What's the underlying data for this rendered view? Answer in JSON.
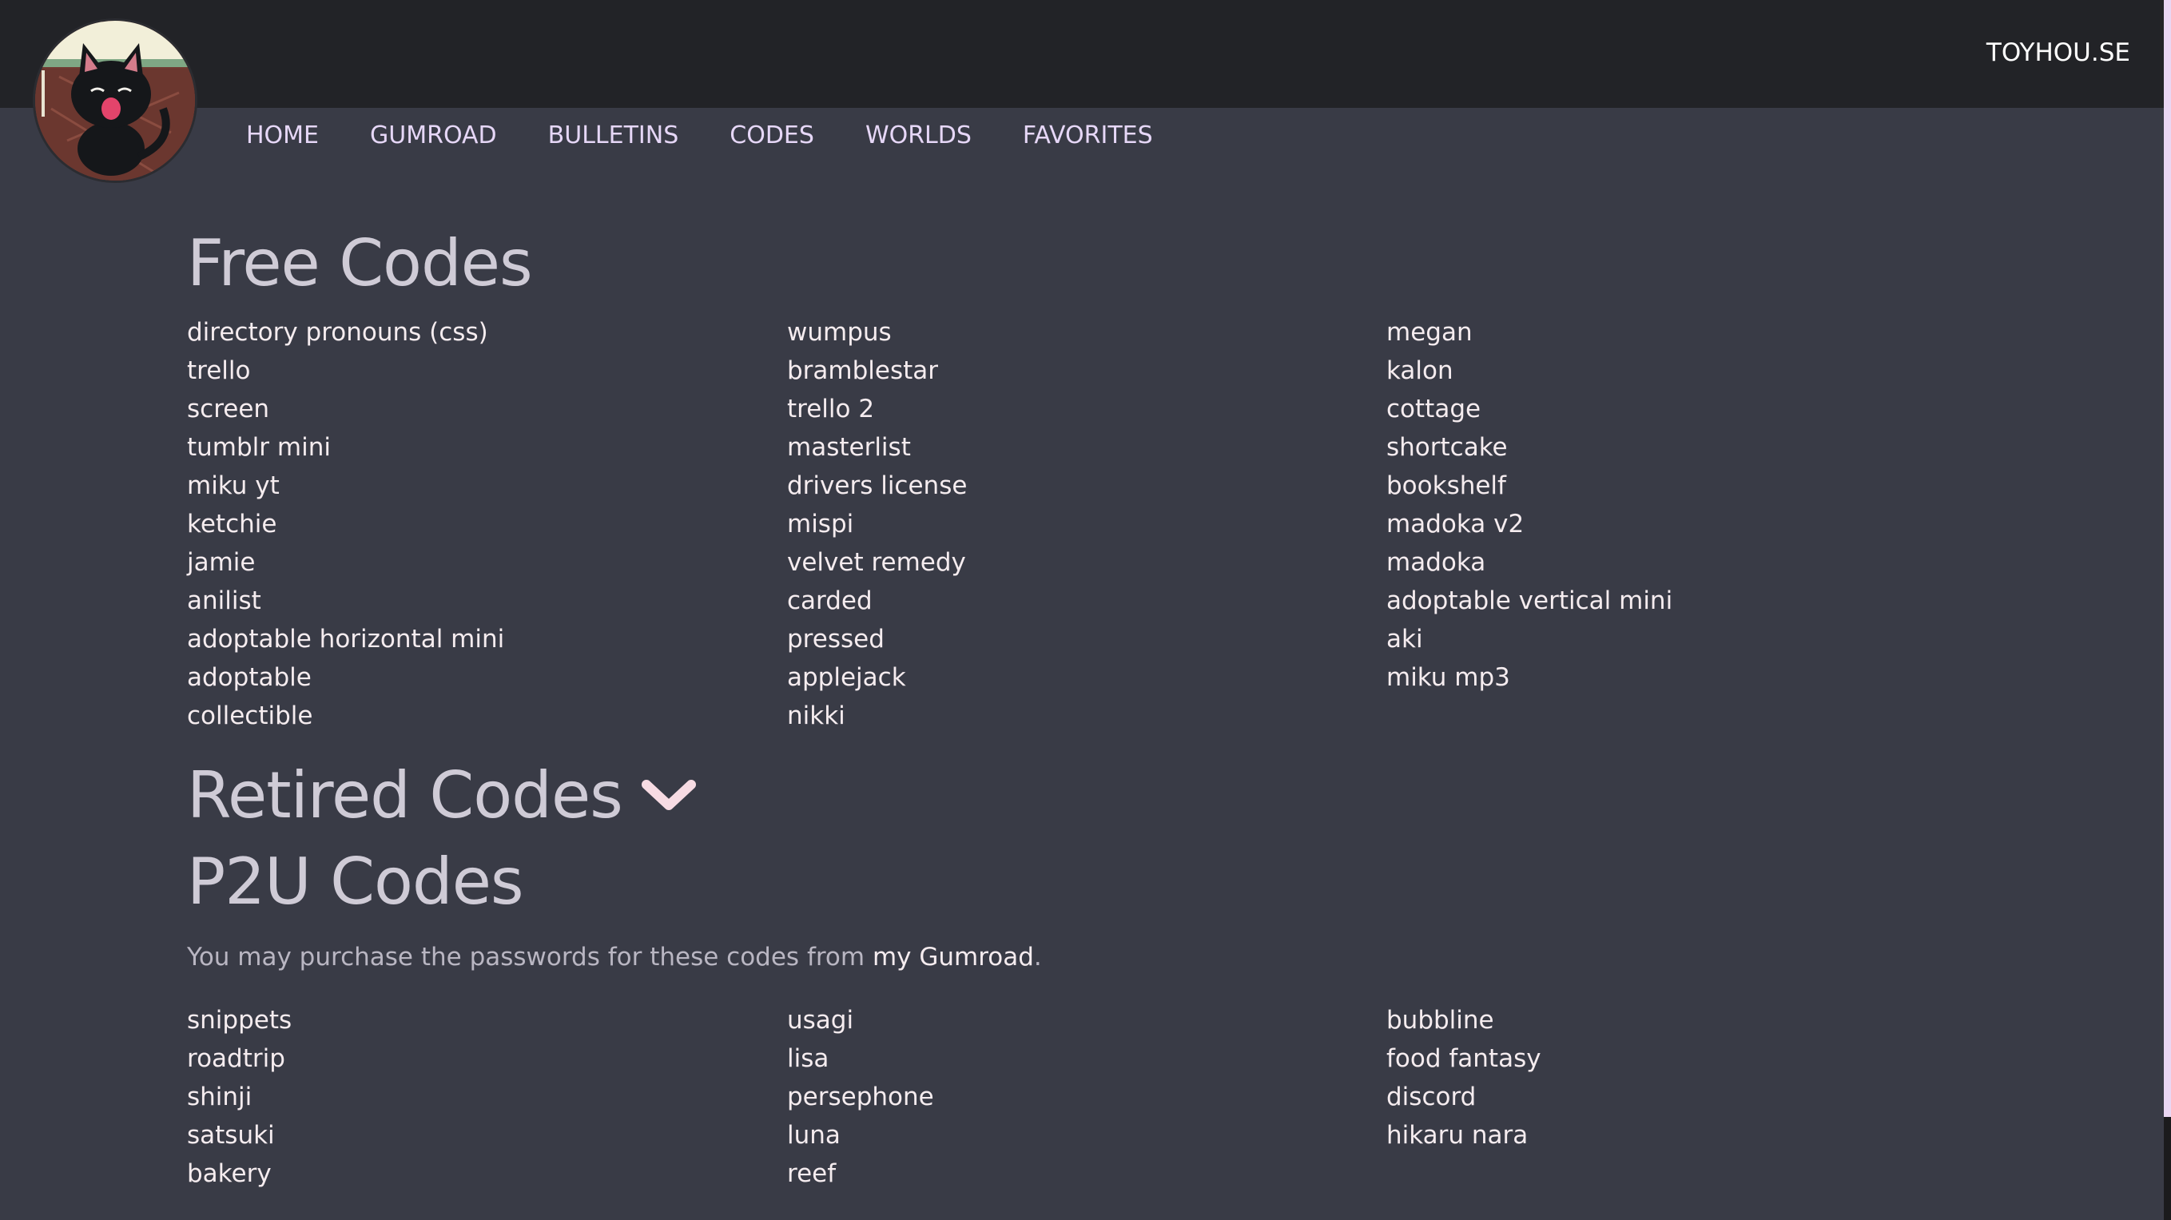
{
  "header": {
    "site_link": "TOYHOU.SE",
    "avatar_icon": "black-cat-avatar-icon"
  },
  "nav": {
    "items": [
      {
        "label": "HOME"
      },
      {
        "label": "GUMROAD"
      },
      {
        "label": "BULLETINS"
      },
      {
        "label": "CODES"
      },
      {
        "label": "WORLDS"
      },
      {
        "label": "FAVORITES"
      }
    ]
  },
  "free_codes": {
    "title": "Free Codes",
    "columns": [
      [
        "directory pronouns (css)",
        "trello",
        "screen",
        "tumblr mini",
        "miku yt",
        "ketchie",
        "jamie",
        "anilist",
        "adoptable horizontal mini",
        "adoptable",
        "collectible"
      ],
      [
        "wumpus",
        "bramblestar",
        "trello 2",
        "masterlist",
        "drivers license",
        "mispi",
        "velvet remedy",
        "carded",
        "pressed",
        "applejack",
        "nikki"
      ],
      [
        "megan",
        "kalon",
        "cottage",
        "shortcake",
        "bookshelf",
        "madoka v2",
        "madoka",
        "adoptable vertical mini",
        "aki",
        "miku mp3"
      ]
    ]
  },
  "retired_codes": {
    "title": "Retired Codes",
    "toggle_icon": "chevron-down-icon"
  },
  "p2u_codes": {
    "title": "P2U Codes",
    "note_prefix": "You may purchase the passwords for these codes from ",
    "note_link": "my Gumroad",
    "note_suffix": ".",
    "columns": [
      [
        "snippets",
        "roadtrip",
        "shinji",
        "satsuki",
        "bakery"
      ],
      [
        "usagi",
        "lisa",
        "persephone",
        "luna",
        "reef"
      ],
      [
        "bubbline",
        "food fantasy",
        "discord",
        "hikaru nara"
      ]
    ]
  },
  "colors": {
    "background": "#393b46",
    "topbar": "#222327",
    "nav_text": "#e6d7f7",
    "link_text": "#f5ecef",
    "heading_text": "#cfcbd6",
    "chevron": "#f7dbe3"
  }
}
